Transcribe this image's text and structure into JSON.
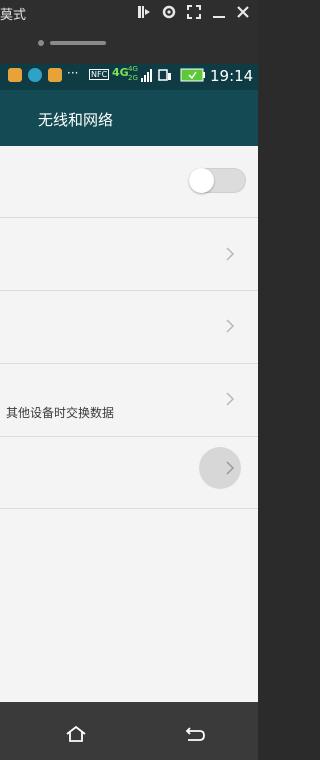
{
  "emulator": {
    "title": "莫式",
    "icons": [
      "exit-icon",
      "gear-icon",
      "fullscreen-icon",
      "minimize-icon",
      "close-icon"
    ]
  },
  "status_bar": {
    "time": "19:14",
    "nfc": "NFC",
    "network_4g": "4G",
    "network_4g_small": "4G",
    "network_2g": "2G",
    "more": "···"
  },
  "action_bar": {
    "title": "无线和网络"
  },
  "settings": {
    "row3_summary": "其他设备时交换数据",
    "toggle_state": "off"
  },
  "nav": {
    "icons": [
      "home-icon",
      "back-icon"
    ]
  },
  "colors": {
    "status_bar": "#0f3c44",
    "action_bar": "#134a54",
    "content_bg": "#f4f4f4",
    "nav_bar": "#3a3a3a"
  }
}
